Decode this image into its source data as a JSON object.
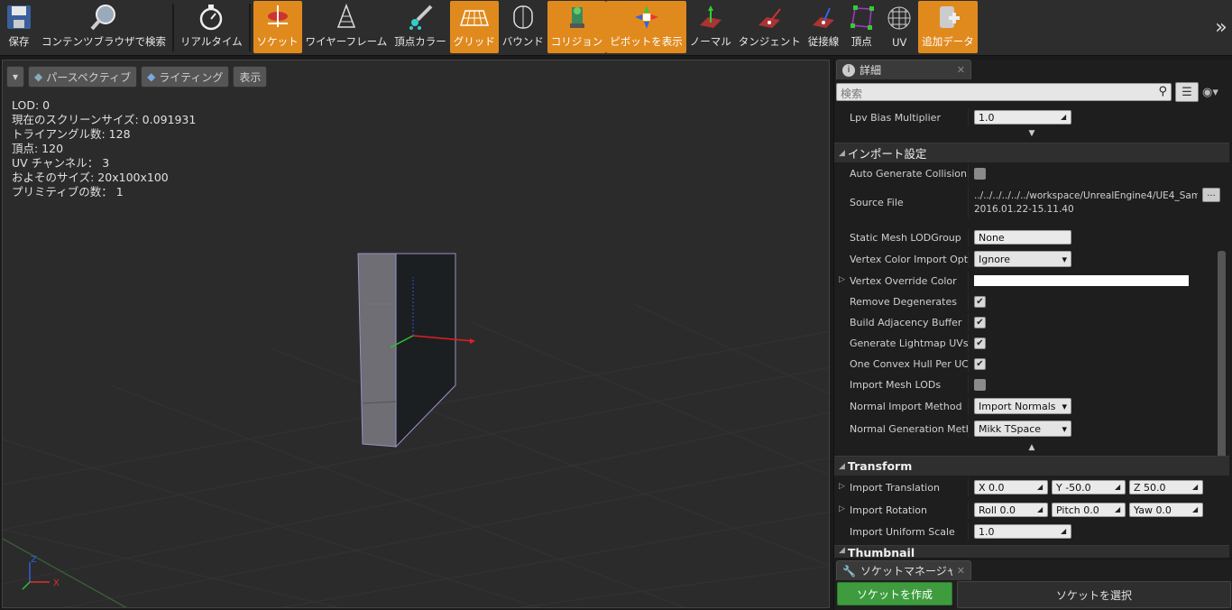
{
  "toolbar": {
    "buttons": [
      {
        "label": "保存",
        "icon": "save-icon",
        "active": false
      },
      {
        "label": "コンテンツブラウザで検索",
        "icon": "magnifier-icon",
        "active": false
      },
      {
        "label": "リアルタイム",
        "icon": "stopwatch-icon",
        "active": false
      },
      {
        "label": "ソケット",
        "icon": "socket-icon",
        "active": true
      },
      {
        "label": "ワイヤーフレーム",
        "icon": "wireframe-icon",
        "active": false
      },
      {
        "label": "頂点カラー",
        "icon": "paint-brush-icon",
        "active": false
      },
      {
        "label": "グリッド",
        "icon": "grid-icon",
        "active": true
      },
      {
        "label": "バウンド",
        "icon": "bounds-icon",
        "active": false
      },
      {
        "label": "コリジョン",
        "icon": "collision-icon",
        "active": true
      },
      {
        "label": "ピボットを表示",
        "icon": "pivot-icon",
        "active": true
      },
      {
        "label": "ノーマル",
        "icon": "normal-icon",
        "active": false
      },
      {
        "label": "タンジェント",
        "icon": "tangent-icon",
        "active": false
      },
      {
        "label": "従接線",
        "icon": "binormal-icon",
        "active": false
      },
      {
        "label": "頂点",
        "icon": "vertex-icon",
        "active": false
      },
      {
        "label": "UV",
        "icon": "uv-icon",
        "active": false
      },
      {
        "label": "追加データ",
        "icon": "add-data-icon",
        "active": true
      }
    ],
    "more": "»"
  },
  "viewport": {
    "perspective_label": "パースペクティブ",
    "lighting_label": "ライティング",
    "show_label": "表示",
    "stats": [
      "LOD: 0",
      "現在のスクリーンサイズ: 0.091931",
      "トライアングル数: 128",
      "頂点: 120",
      "UV チャンネル： 3",
      "およそのサイズ: 20x100x100",
      "プリミティブの数： 1"
    ],
    "axis_z": "Z",
    "axis_x": "X"
  },
  "details": {
    "tab_label": "詳細",
    "search_placeholder": "検索",
    "lpv": {
      "label": "Lpv Bias Multiplier",
      "value": "1.0"
    },
    "import_section": "インポート設定",
    "auto_collision": {
      "label": "Auto Generate Collision",
      "checked": false
    },
    "source_file": {
      "label": "Source File",
      "path": "../../../../../../workspace/UnrealEngine4/UE4_Sam",
      "date": "2016.01.22-15.11.40",
      "browse": "..."
    },
    "lod_group": {
      "label": "Static Mesh LODGroup",
      "value": "None"
    },
    "vertex_color_import": {
      "label": "Vertex Color Import Optio",
      "value": "Ignore"
    },
    "vertex_override": {
      "label": "Vertex Override Color"
    },
    "checks": [
      {
        "label": "Remove Degenerates",
        "checked": true
      },
      {
        "label": "Build Adjacency Buffer",
        "checked": true
      },
      {
        "label": "Generate Lightmap UVs",
        "checked": true
      },
      {
        "label": "One Convex Hull Per UCX",
        "checked": true
      },
      {
        "label": "Import Mesh LODs",
        "checked": false
      }
    ],
    "normal_import": {
      "label": "Normal Import Method",
      "value": "Import Normals"
    },
    "normal_generation": {
      "label": "Normal Generation Metho",
      "value": "Mikk TSpace"
    },
    "transform_section": "Transform",
    "translation": {
      "label": "Import Translation",
      "x": "X  0.0",
      "y": "Y  -50.0",
      "z": "Z  50.0"
    },
    "rotation": {
      "label": "Import Rotation",
      "roll": "Roll  0.0",
      "pitch": "Pitch  0.0",
      "yaw": "Yaw  0.0"
    },
    "uniform_scale": {
      "label": "Import Uniform Scale",
      "value": "1.0"
    },
    "thumbnail_section": "Thumbnail"
  },
  "socket_manager": {
    "tab_label": "ソケットマネージャ",
    "create_button": "ソケットを作成",
    "select_button": "ソケットを選択"
  },
  "colors": {
    "accent": "#e08a1e",
    "create_green": "#3e9c3e",
    "panel_bg": "#1e1e1e",
    "viewport_bg": "#2b2b2b"
  }
}
